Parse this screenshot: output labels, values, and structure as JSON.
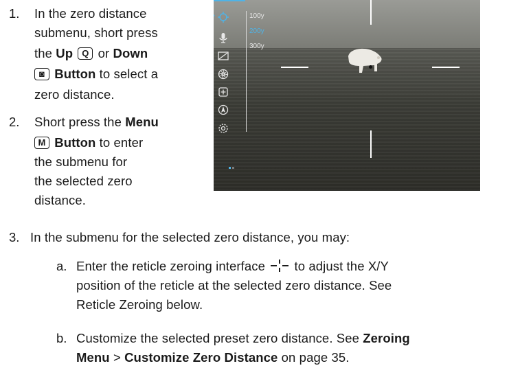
{
  "steps": [
    {
      "number": "1.",
      "line1": "In the zero distance",
      "line2": "submenu, short press",
      "line3_pre": "the ",
      "up_label": "Up",
      "up_key": "Q",
      "or_text": " or ",
      "down_label": "Down",
      "down_key": "◙",
      "button_word": "Button",
      "line4_post": " to select a",
      "line5": "zero distance."
    },
    {
      "number": "2.",
      "line1_pre": "Short press the ",
      "menu_label": "Menu",
      "menu_key": "M",
      "button_word": "Button",
      "line2_post": " to enter",
      "line3": "the submenu for",
      "line4": "the selected zero",
      "line5": "distance."
    },
    {
      "number": "3.",
      "text": "In the submenu for the selected zero distance, you may:"
    }
  ],
  "substeps": [
    {
      "letter": "a.",
      "line1_pre": "Enter the reticle zeroing interface",
      "line1_post": "to adjust the X/Y",
      "line2": "position of the reticle at the selected zero distance. See",
      "line3": "Reticle Zeroing below."
    },
    {
      "letter": "b.",
      "line1_pre": "Customize the selected preset zero distance. See ",
      "line1_bold": "Zeroing",
      "line2_bold1": "Menu",
      "line2_sep": " > ",
      "line2_bold2": "Customize Zero Distance",
      "line2_post": " on page 35."
    }
  ],
  "scope": {
    "distances": [
      "100y",
      "200y",
      "300y"
    ],
    "selected_index": 1,
    "menu_icons": [
      "zero-target-icon",
      "microphone-icon",
      "picture-in-picture-icon",
      "aperture-icon",
      "add-square-icon",
      "compass-icon",
      "settings-gear-icon"
    ],
    "accent_color": "#4fb3e6"
  }
}
